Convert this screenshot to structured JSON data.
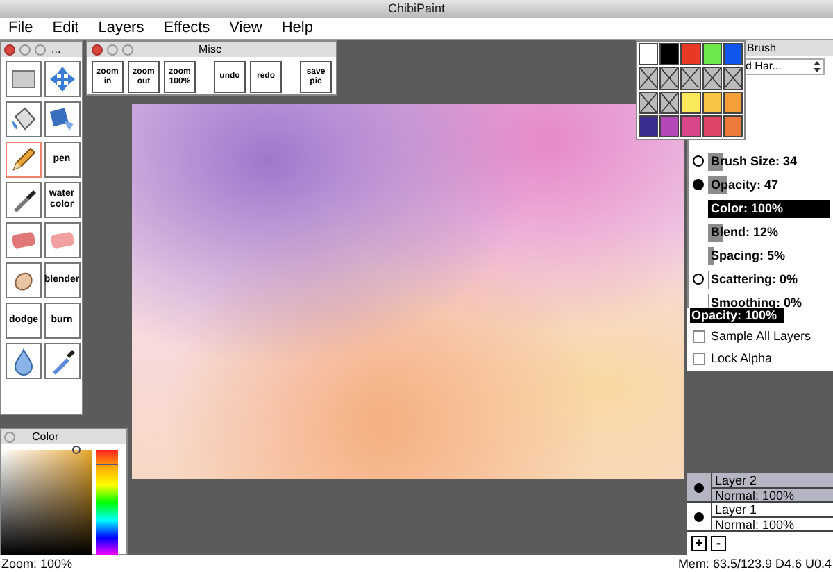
{
  "window": {
    "title": "ChibiPaint"
  },
  "menu": [
    "File",
    "Edit",
    "Layers",
    "Effects",
    "View",
    "Help"
  ],
  "tools_panel": {
    "title": "...",
    "tools": [
      {
        "kind": "icon",
        "selected": false
      },
      {
        "kind": "icon",
        "selected": false
      },
      {
        "kind": "icon",
        "selected": false
      },
      {
        "kind": "icon",
        "selected": false
      },
      {
        "kind": "icon",
        "selected": true
      },
      {
        "kind": "text",
        "label": "pen",
        "selected": false
      },
      {
        "kind": "icon",
        "selected": false
      },
      {
        "kind": "text",
        "label": "water color",
        "selected": false
      },
      {
        "kind": "icon",
        "selected": false
      },
      {
        "kind": "icon",
        "selected": false
      },
      {
        "kind": "icon",
        "selected": false
      },
      {
        "kind": "text",
        "label": "blender",
        "selected": false
      },
      {
        "kind": "text",
        "label": "dodge",
        "selected": false
      },
      {
        "kind": "text",
        "label": "burn",
        "selected": false
      },
      {
        "kind": "icon",
        "selected": false
      },
      {
        "kind": "icon",
        "selected": false
      }
    ]
  },
  "misc_panel": {
    "title": "Misc",
    "buttons": [
      "zoom in",
      "zoom out",
      "zoom 100%",
      "undo",
      "redo",
      "save pic"
    ]
  },
  "swatches": [
    {
      "kind": "color",
      "color": "#ffffff"
    },
    {
      "kind": "color",
      "color": "#000000"
    },
    {
      "kind": "color",
      "color": "#e83a22"
    },
    {
      "kind": "color",
      "color": "#6ee84a"
    },
    {
      "kind": "color",
      "color": "#1155ee"
    },
    {
      "kind": "empty"
    },
    {
      "kind": "empty"
    },
    {
      "kind": "empty"
    },
    {
      "kind": "empty"
    },
    {
      "kind": "empty"
    },
    {
      "kind": "empty"
    },
    {
      "kind": "empty"
    },
    {
      "kind": "color",
      "color": "#f8e85a"
    },
    {
      "kind": "color",
      "color": "#f8c444"
    },
    {
      "kind": "color",
      "color": "#f4a03a"
    },
    {
      "kind": "color",
      "color": "#3a2f90"
    },
    {
      "kind": "color",
      "color": "#b448b8"
    },
    {
      "kind": "color",
      "color": "#d84888"
    },
    {
      "kind": "color",
      "color": "#e04466"
    },
    {
      "kind": "color",
      "color": "#ec7a3a"
    }
  ],
  "brush_panel": {
    "title": "Brush",
    "brush_select": "d Har...",
    "settings": [
      {
        "kind": "radio",
        "label": "Brush Size: 34",
        "selected": false,
        "level": 0.13
      },
      {
        "kind": "radio",
        "label": "Opacity: 47",
        "selected": true,
        "level": 0.16
      },
      {
        "kind": "plain",
        "label": "Color: 100%",
        "level": 1
      },
      {
        "kind": "plain",
        "label": "Blend: 12%",
        "level": 0.12
      },
      {
        "kind": "plain",
        "label": "Spacing: 5%",
        "level": 0.05
      },
      {
        "kind": "radio",
        "label": "Scattering: 0%",
        "selected": false,
        "level": 0
      },
      {
        "kind": "plain",
        "label": "Smoothing: 0%",
        "level": 0
      }
    ]
  },
  "layers_panel": {
    "opacity": {
      "label": "Opacity: 100%",
      "level": 1
    },
    "sample_all_layers": {
      "label": "Sample All Layers",
      "checked": false
    },
    "lock_alpha": {
      "label": "Lock Alpha",
      "checked": false
    },
    "layers": [
      {
        "name": "Layer 2",
        "mode": "Normal: 100%",
        "visible": true,
        "selected": true
      },
      {
        "name": "Layer 1",
        "mode": "Normal: 100%",
        "visible": true,
        "selected": false
      }
    ],
    "buttons": [
      "+",
      "-"
    ]
  },
  "color_panel": {
    "title": "Color"
  },
  "status_bar": {
    "zoom": "Zoom: 100%",
    "memory": "Mem: 63.5/123.9 D4.6 U0.4"
  }
}
